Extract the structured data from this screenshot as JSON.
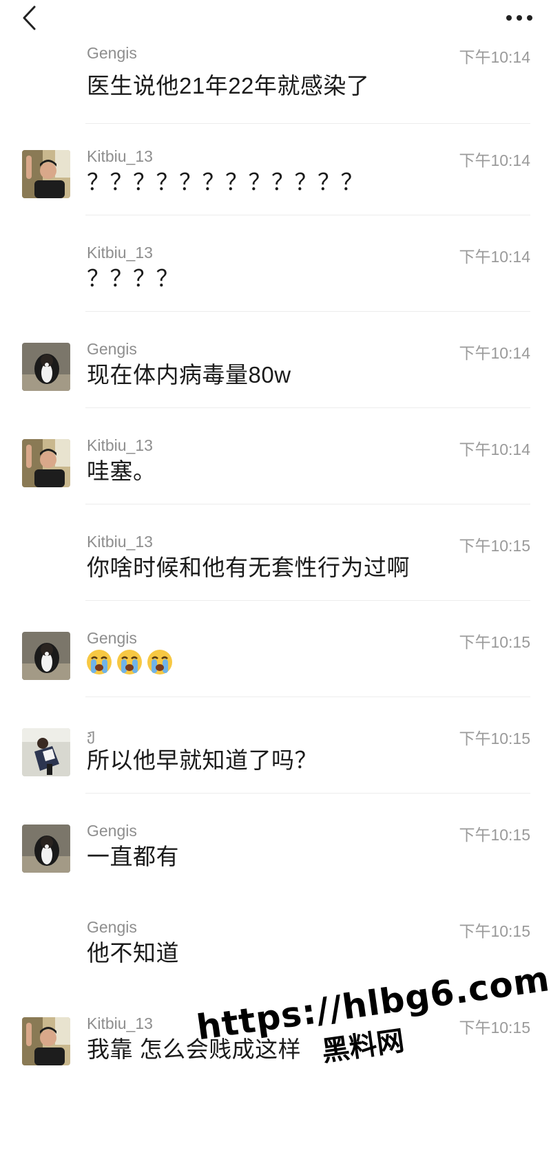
{
  "header": {
    "back_icon": "chevron-left-icon",
    "more_icon": "more-horizontal-icon"
  },
  "messages": [
    {
      "sender": "Gengis",
      "time": "下午10:14",
      "text": "医生说他21年22年就感染了",
      "avatar": "dog"
    },
    {
      "sender": "Kitbiu_13",
      "time": "下午10:14",
      "text": "？？？？？？？？？？？？",
      "avatar": "man"
    },
    {
      "sender": "Kitbiu_13",
      "time": "下午10:14",
      "text": "？？？？",
      "avatar": "none"
    },
    {
      "sender": "Gengis",
      "time": "下午10:14",
      "text": "现在体内病毒量80w",
      "avatar": "dog"
    },
    {
      "sender": "Kitbiu_13",
      "time": "下午10:14",
      "text": "哇塞。",
      "avatar": "man"
    },
    {
      "sender": "Kitbiu_13",
      "time": "下午10:15",
      "text": "你啥时候和他有无套性行为过啊",
      "avatar": "none"
    },
    {
      "sender": "Gengis",
      "time": "下午10:15",
      "text": "",
      "emoji": [
        "crying-face-icon",
        "crying-face-icon",
        "crying-face-icon"
      ],
      "avatar": "dog"
    },
    {
      "sender": "ჟ",
      "time": "下午10:15",
      "text": "所以他早就知道了吗？",
      "avatar": "person"
    },
    {
      "sender": "Gengis",
      "time": "下午10:15",
      "text": "一直都有",
      "avatar": "dog"
    },
    {
      "sender": "Gengis",
      "time": "下午10:15",
      "text": "他不知道",
      "avatar": "none"
    },
    {
      "sender": "Kitbiu_13",
      "time": "下午10:15",
      "text": "我靠 怎么会贱成这样",
      "avatar": "man"
    }
  ],
  "watermark": {
    "url": "https://hlbg6.com",
    "name": "黑料网"
  }
}
